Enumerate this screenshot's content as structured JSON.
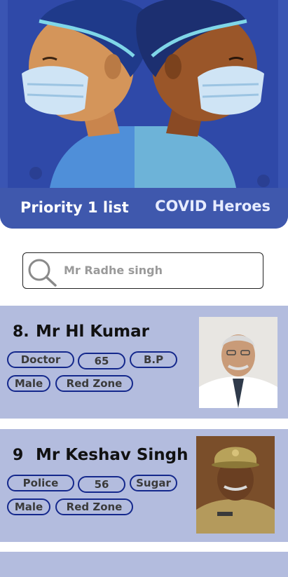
{
  "banner": {
    "left_text": "Priority 1 list",
    "right_text": "COVID Heroes"
  },
  "search": {
    "value": "Mr Radhe singh"
  },
  "cards": [
    {
      "number": "8.",
      "name": "Mr Hl Kumar",
      "tags": [
        "Doctor",
        "65",
        "B.P",
        "Male",
        "Red Zone"
      ]
    },
    {
      "number": "9",
      "name": "Mr Keshav Singh",
      "tags": [
        "Police",
        "56",
        "Sugar",
        "Male",
        "Red Zone"
      ]
    }
  ],
  "colors": {
    "banner": "#3a55b3",
    "card": "#b3bcde",
    "tag_border": "#14288c"
  }
}
